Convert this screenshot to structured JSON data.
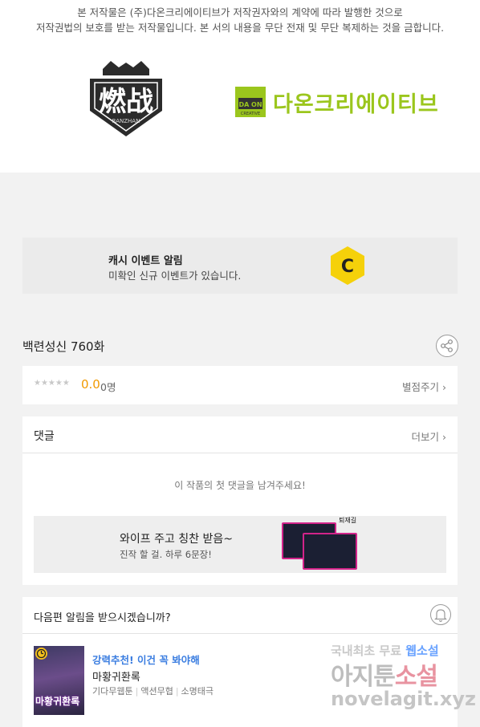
{
  "copyright": {
    "line1": "본 저작물은 (주)다온크리에이티브가 저작권자와의 계약에 따라 발행한 것으로",
    "line2": "저작권법의 보호를 받는 저작물입니다. 본 서의 내용을 무단 전재 및 무단 복제하는 것을 금합니다."
  },
  "logos": {
    "left_text": "燃战",
    "left_sub": "RANZHAN",
    "right_box": "DA ON",
    "right_box_sub": "CREATIVE",
    "right_name": "다온크리에이티브",
    "right_color": "#9bc61d"
  },
  "cash_event": {
    "title": "캐시 이벤트 알림",
    "subtitle": "미확인 신규 이벤트가 있습니다.",
    "coin_letter": "C",
    "coin_color": "#f5d10a"
  },
  "episode": {
    "title": "백련성신 760화",
    "share_icon": "share-icon"
  },
  "rating": {
    "stars": "★★★★★",
    "score": "0.0",
    "count": "0명",
    "rate_link": "별점주기 ›"
  },
  "comments": {
    "heading": "댓글",
    "more": "더보기 ›",
    "empty": "이 작품의 첫 댓글을 남겨주세요!",
    "banner": {
      "title": "와이프 주고 칭찬 받음~",
      "subtitle": "진작 할 걸. 하루 6문장!",
      "tag": "퇴재길"
    }
  },
  "notify": {
    "question": "다음편 알림을 받으시겠습니까?",
    "bell_icon": "bell-icon"
  },
  "recommend": {
    "tag": "강력추천! 이건 꼭 봐야해",
    "title": "마황귀환록",
    "thumb_title": "마황귀환록",
    "genres": [
      "기다무웹툰",
      "액션무협",
      "소명태극"
    ]
  },
  "watermark": {
    "line1_a": "국내최초 무료 ",
    "line1_b": "웹소설",
    "line2_a": "아지툰",
    "line2_b": "소설",
    "line3": "novelagit.xyz"
  }
}
